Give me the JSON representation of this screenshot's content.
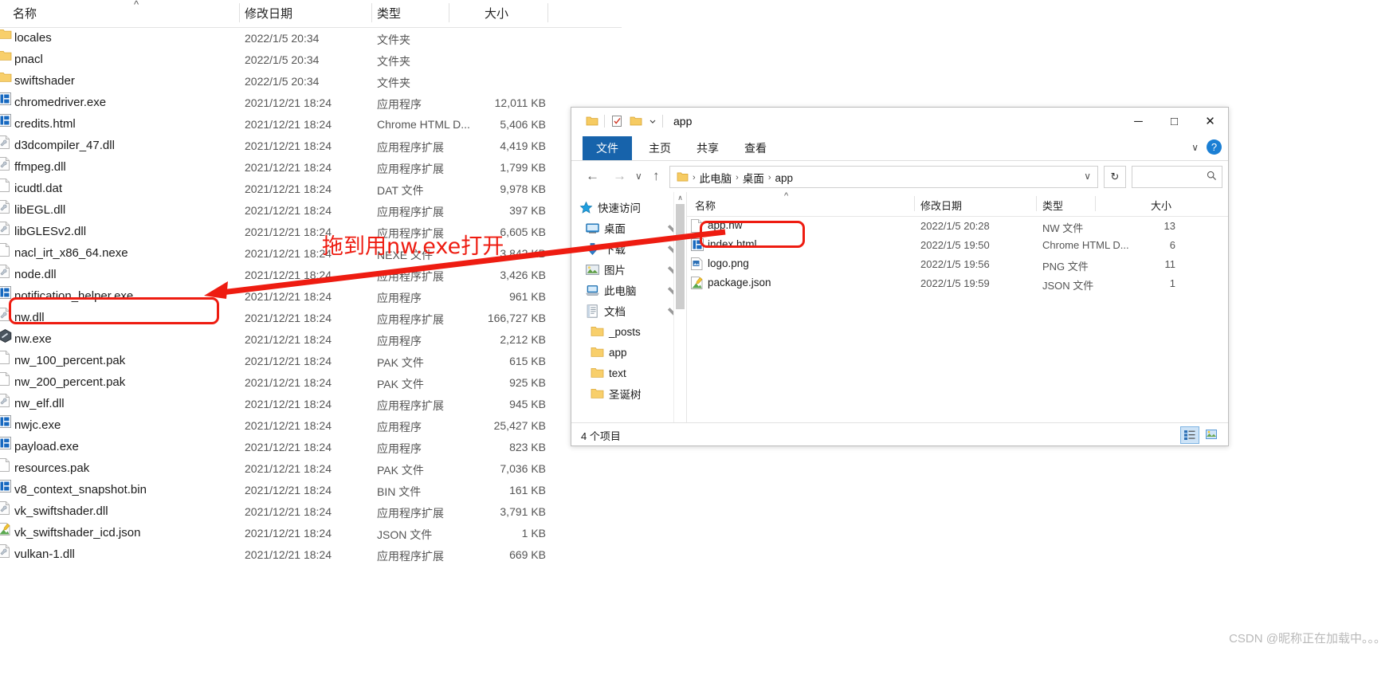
{
  "background_explorer": {
    "columns": [
      "名称",
      "修改日期",
      "类型",
      "大小"
    ],
    "sort_indicator": "^",
    "rows": [
      {
        "icon": "folder-icon",
        "name": "locales",
        "date": "2022/1/5 20:34",
        "type": "文件夹",
        "size": ""
      },
      {
        "icon": "folder-icon",
        "name": "pnacl",
        "date": "2022/1/5 20:34",
        "type": "文件夹",
        "size": ""
      },
      {
        "icon": "folder-icon",
        "name": "swiftshader",
        "date": "2022/1/5 20:34",
        "type": "文件夹",
        "size": ""
      },
      {
        "icon": "exe-icon",
        "name": "chromedriver.exe",
        "date": "2021/12/21 18:24",
        "type": "应用程序",
        "size": "12,011 KB"
      },
      {
        "icon": "exe-icon",
        "name": "credits.html",
        "date": "2021/12/21 18:24",
        "type": "Chrome HTML D...",
        "size": "5,406 KB"
      },
      {
        "icon": "dll-icon",
        "name": "d3dcompiler_47.dll",
        "date": "2021/12/21 18:24",
        "type": "应用程序扩展",
        "size": "4,419 KB"
      },
      {
        "icon": "dll-icon",
        "name": "ffmpeg.dll",
        "date": "2021/12/21 18:24",
        "type": "应用程序扩展",
        "size": "1,799 KB"
      },
      {
        "icon": "doc-icon",
        "name": "icudtl.dat",
        "date": "2021/12/21 18:24",
        "type": "DAT 文件",
        "size": "9,978 KB"
      },
      {
        "icon": "dll-icon",
        "name": "libEGL.dll",
        "date": "2021/12/21 18:24",
        "type": "应用程序扩展",
        "size": "397 KB"
      },
      {
        "icon": "dll-icon",
        "name": "libGLESv2.dll",
        "date": "2021/12/21 18:24",
        "type": "应用程序扩展",
        "size": "6,605 KB"
      },
      {
        "icon": "doc-icon",
        "name": "nacl_irt_x86_64.nexe",
        "date": "2021/12/21 18:24",
        "type": "NEXE 文件",
        "size": "3,842 KB"
      },
      {
        "icon": "dll-icon",
        "name": "node.dll",
        "date": "2021/12/21 18:24",
        "type": "应用程序扩展",
        "size": "3,426 KB"
      },
      {
        "icon": "exe-icon",
        "name": "notification_helper.exe",
        "date": "2021/12/21 18:24",
        "type": "应用程序",
        "size": "961 KB"
      },
      {
        "icon": "dll-icon",
        "name": "nw.dll",
        "date": "2021/12/21 18:24",
        "type": "应用程序扩展",
        "size": "166,727 KB"
      },
      {
        "icon": "nw-icon",
        "name": "nw.exe",
        "date": "2021/12/21 18:24",
        "type": "应用程序",
        "size": "2,212 KB"
      },
      {
        "icon": "doc-icon",
        "name": "nw_100_percent.pak",
        "date": "2021/12/21 18:24",
        "type": "PAK 文件",
        "size": "615 KB"
      },
      {
        "icon": "doc-icon",
        "name": "nw_200_percent.pak",
        "date": "2021/12/21 18:24",
        "type": "PAK 文件",
        "size": "925 KB"
      },
      {
        "icon": "dll-icon",
        "name": "nw_elf.dll",
        "date": "2021/12/21 18:24",
        "type": "应用程序扩展",
        "size": "945 KB"
      },
      {
        "icon": "exe-icon",
        "name": "nwjc.exe",
        "date": "2021/12/21 18:24",
        "type": "应用程序",
        "size": "25,427 KB"
      },
      {
        "icon": "exe-icon",
        "name": "payload.exe",
        "date": "2021/12/21 18:24",
        "type": "应用程序",
        "size": "823 KB"
      },
      {
        "icon": "doc-icon",
        "name": "resources.pak",
        "date": "2021/12/21 18:24",
        "type": "PAK 文件",
        "size": "7,036 KB"
      },
      {
        "icon": "exe-icon",
        "name": "v8_context_snapshot.bin",
        "date": "2021/12/21 18:24",
        "type": "BIN 文件",
        "size": "161 KB"
      },
      {
        "icon": "dll-icon",
        "name": "vk_swiftshader.dll",
        "date": "2021/12/21 18:24",
        "type": "应用程序扩展",
        "size": "3,791 KB"
      },
      {
        "icon": "json-icon",
        "name": "vk_swiftshader_icd.json",
        "date": "2021/12/21 18:24",
        "type": "JSON 文件",
        "size": "1 KB"
      },
      {
        "icon": "dll-icon",
        "name": "vulkan-1.dll",
        "date": "2021/12/21 18:24",
        "type": "应用程序扩展",
        "size": "669 KB"
      }
    ]
  },
  "window": {
    "title": "app",
    "quick_access_icons": [
      "folder-icon",
      "properties-icon",
      "new-folder-icon",
      "chevron-down-icon"
    ],
    "window_buttons": {
      "minimize": "─",
      "maximize": "□",
      "close": "✕"
    },
    "ribbon_tabs": [
      {
        "label": "文件",
        "active": true
      },
      {
        "label": "主页",
        "active": false
      },
      {
        "label": "共享",
        "active": false
      },
      {
        "label": "查看",
        "active": false
      }
    ],
    "ribbon_right": {
      "collapse": "∨",
      "help": "?"
    },
    "nav": {
      "back": "←",
      "forward": "→",
      "recent": "∨",
      "up": "↑",
      "breadcrumb": [
        "此电脑",
        "桌面",
        "app"
      ],
      "breadcrumb_separator": "›",
      "address_caret": "∨",
      "refresh": "↻",
      "search_icon": "search-icon",
      "search_placeholder": ""
    },
    "sidebar": {
      "scroll_up": "∧",
      "scroll_down": "∨",
      "items": [
        {
          "label": "快速访问",
          "icon": "star-icon",
          "pinned": false
        },
        {
          "label": "桌面",
          "icon": "desktop-icon",
          "pinned": true
        },
        {
          "label": "下载",
          "icon": "download-icon",
          "pinned": true
        },
        {
          "label": "图片",
          "icon": "pictures-icon",
          "pinned": true
        },
        {
          "label": "此电脑",
          "icon": "this-pc-icon",
          "pinned": true
        },
        {
          "label": "文档",
          "icon": "documents-icon",
          "pinned": true
        },
        {
          "label": "_posts",
          "icon": "folder-icon",
          "pinned": false
        },
        {
          "label": "app",
          "icon": "folder-icon",
          "pinned": false
        },
        {
          "label": "text",
          "icon": "folder-icon",
          "pinned": false
        },
        {
          "label": "圣诞树",
          "icon": "folder-icon",
          "pinned": false
        }
      ]
    },
    "file_list": {
      "columns": [
        "名称",
        "修改日期",
        "类型",
        "大小"
      ],
      "sort_indicator": "^",
      "rows": [
        {
          "icon": "doc-icon",
          "name": "app.nw",
          "date": "2022/1/5 20:28",
          "type": "NW 文件",
          "size": "13"
        },
        {
          "icon": "exe-icon",
          "name": "index.html",
          "date": "2022/1/5 19:50",
          "type": "Chrome HTML D...",
          "size": "6"
        },
        {
          "icon": "png-icon",
          "name": "logo.png",
          "date": "2022/1/5 19:56",
          "type": "PNG 文件",
          "size": "11"
        },
        {
          "icon": "json-icon",
          "name": "package.json",
          "date": "2022/1/5 19:59",
          "type": "JSON 文件",
          "size": "1"
        }
      ],
      "hscroll_left": "‹",
      "hscroll_right": "›"
    },
    "status": {
      "count_text": "4 个项目",
      "view_buttons": [
        "details-view-icon",
        "large-icons-view-icon"
      ]
    }
  },
  "annotations": {
    "instruction_text": "拖到用nw.exe打开",
    "color": "#ee1c11",
    "highlight_targets": [
      "nw.exe",
      "app.nw"
    ]
  },
  "watermark": "CSDN @昵称正在加载中。。。"
}
